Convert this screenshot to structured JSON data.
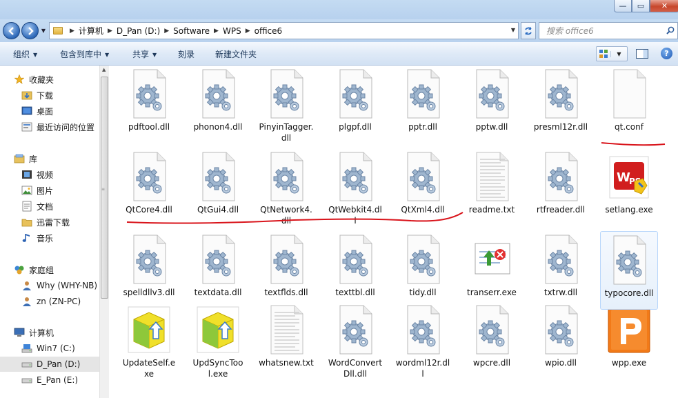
{
  "window": {
    "buttons": {
      "minimize": "—",
      "maximize": "▭",
      "close": "✕"
    }
  },
  "address_bar": {
    "breadcrumbs": [
      "计算机",
      "D_Pan (D:)",
      "Software",
      "WPS",
      "office6"
    ],
    "search_placeholder": "搜索 office6"
  },
  "command_bar": {
    "items": [
      "组织",
      "包含到库中",
      "共享",
      "刻录",
      "新建文件夹"
    ]
  },
  "nav_pane": {
    "favorites_header": "收藏夹",
    "favorites": [
      "下载",
      "桌面",
      "最近访问的位置"
    ],
    "libraries_header": "库",
    "libraries": [
      "视频",
      "图片",
      "文档",
      "迅雷下载",
      "音乐"
    ],
    "homegroup_header": "家庭组",
    "homegroup": [
      "Why (WHY-NB)",
      "zn (ZN-PC)"
    ],
    "computer_header": "计算机",
    "drives": [
      "Win7 (C:)",
      "D_Pan (D:)",
      "E_Pan (E:)"
    ],
    "selected": "D_Pan (D:)"
  },
  "files": [
    {
      "name": "pdftool.dll",
      "icon": "dll-gear-icon"
    },
    {
      "name": "phonon4.dll",
      "icon": "dll-gear-icon"
    },
    {
      "name": "PinyinTagger.dll",
      "icon": "dll-gear-icon"
    },
    {
      "name": "plgpf.dll",
      "icon": "dll-gear-icon"
    },
    {
      "name": "pptr.dll",
      "icon": "dll-gear-icon"
    },
    {
      "name": "pptw.dll",
      "icon": "dll-gear-icon"
    },
    {
      "name": "presml12r.dll",
      "icon": "dll-gear-icon"
    },
    {
      "name": "qt.conf",
      "icon": "blank-file-icon"
    },
    {
      "name": "QtCore4.dll",
      "icon": "dll-gear-icon"
    },
    {
      "name": "QtGui4.dll",
      "icon": "dll-gear-icon"
    },
    {
      "name": "QtNetwork4.dll",
      "icon": "dll-gear-icon"
    },
    {
      "name": "QtWebkit4.dll",
      "icon": "dll-gear-icon"
    },
    {
      "name": "QtXml4.dll",
      "icon": "dll-gear-icon"
    },
    {
      "name": "readme.txt",
      "icon": "text-file-icon"
    },
    {
      "name": "rtfreader.dll",
      "icon": "dll-gear-icon"
    },
    {
      "name": "setlang.exe",
      "icon": "wps-setlang-icon"
    },
    {
      "name": "spelldllv3.dll",
      "icon": "dll-gear-icon"
    },
    {
      "name": "textdata.dll",
      "icon": "dll-gear-icon"
    },
    {
      "name": "textflds.dll",
      "icon": "dll-gear-icon"
    },
    {
      "name": "texttbl.dll",
      "icon": "dll-gear-icon"
    },
    {
      "name": "tidy.dll",
      "icon": "dll-gear-icon"
    },
    {
      "name": "transerr.exe",
      "icon": "error-report-icon"
    },
    {
      "name": "txtrw.dll",
      "icon": "dll-gear-icon"
    },
    {
      "name": "typocore.dll",
      "icon": "dll-gear-icon"
    },
    {
      "name": "UpdateSelf.exe",
      "icon": "update-box-icon"
    },
    {
      "name": "UpdSyncTool.exe",
      "icon": "update-box-icon"
    },
    {
      "name": "whatsnew.txt",
      "icon": "text-file-icon"
    },
    {
      "name": "WordConvertDll.dll",
      "icon": "dll-gear-icon"
    },
    {
      "name": "wordml12r.dll",
      "icon": "dll-gear-icon"
    },
    {
      "name": "wpcre.dll",
      "icon": "dll-gear-icon"
    },
    {
      "name": "wpio.dll",
      "icon": "dll-gear-icon"
    },
    {
      "name": "wpp.exe",
      "icon": "wps-presentation-icon"
    }
  ],
  "hovered_file": "typocore.dll",
  "annotation_color": "#d9141b"
}
